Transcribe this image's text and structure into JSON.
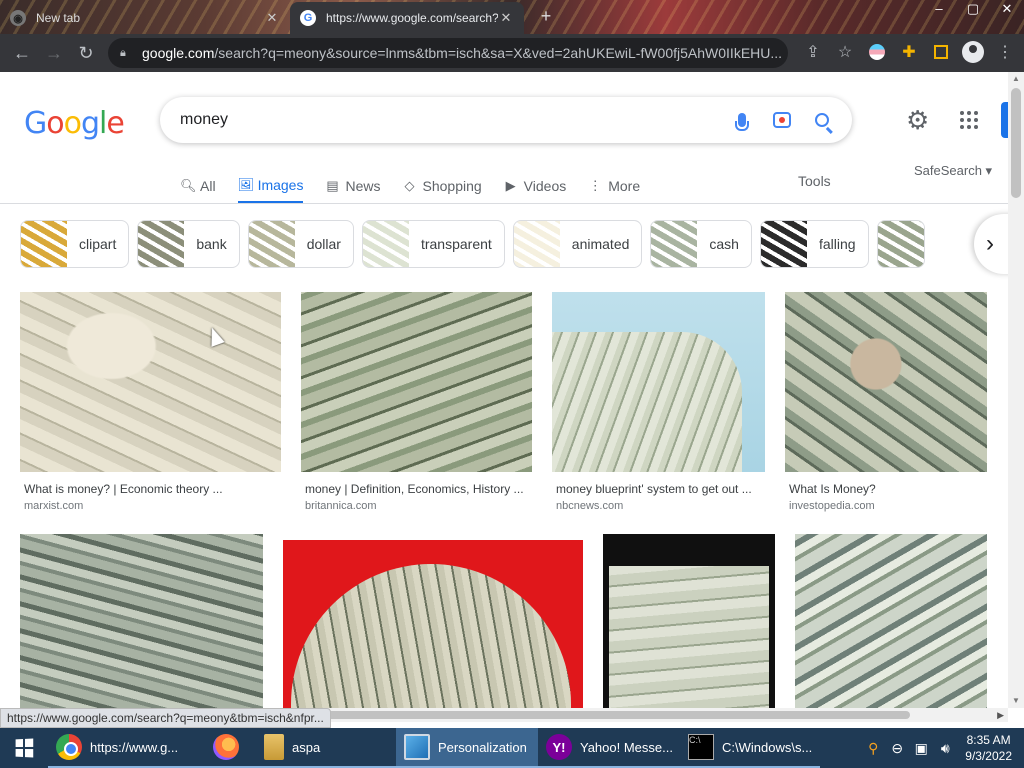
{
  "browser": {
    "tabs": [
      {
        "title": "New tab",
        "active": false
      },
      {
        "title": "https://www.google.com/search?",
        "active": true
      }
    ],
    "new_tab": "+",
    "window_controls": [
      "–",
      "▢",
      "✕"
    ],
    "url_domain": "google.com",
    "url_rest": "/search?q=meony&source=lnms&tbm=isch&sa=X&ved=2ahUKEwiL-fW00fj5AhW0IIkEHU..."
  },
  "google": {
    "logo_letters": [
      "G",
      "o",
      "o",
      "g",
      "l",
      "e"
    ],
    "query": "money",
    "nav_tabs": [
      {
        "label": "All",
        "icon": "🔍︎"
      },
      {
        "label": "Images",
        "icon": "🖼︎"
      },
      {
        "label": "News",
        "icon": "▤"
      },
      {
        "label": "Shopping",
        "icon": "◇"
      },
      {
        "label": "Videos",
        "icon": "▶"
      },
      {
        "label": "More",
        "icon": "⋮"
      }
    ],
    "tools_label": "Tools",
    "safesearch_label": "SafeSearch ▾",
    "chips": [
      {
        "label": "clipart",
        "color": "#d9a93a"
      },
      {
        "label": "bank",
        "color": "#8c8f7a"
      },
      {
        "label": "dollar",
        "color": "#b7b79c"
      },
      {
        "label": "transparent",
        "color": "#dde3d2"
      },
      {
        "label": "animated",
        "color": "#f5f0df"
      },
      {
        "label": "cash",
        "color": "#a9b4a1"
      },
      {
        "label": "falling",
        "color": "#2b2b2b"
      },
      {
        "label": "",
        "color": "#9aa58e"
      }
    ],
    "results": [
      {
        "caption": "What is money? | Economic theory ...",
        "source": "marxist.com"
      },
      {
        "caption": "money | Definition, Economics, History ...",
        "source": "britannica.com"
      },
      {
        "caption": "money blueprint' system to get out ...",
        "source": "nbcnews.com"
      },
      {
        "caption": "What Is Money?",
        "source": "investopedia.com"
      },
      {
        "caption": "",
        "source": ""
      },
      {
        "caption": "",
        "source": ""
      },
      {
        "caption": "",
        "source": ""
      },
      {
        "caption": "",
        "source": ""
      }
    ]
  },
  "status_url": "https://www.google.com/search?q=meony&tbm=isch&nfpr...",
  "taskbar": {
    "items": [
      {
        "label": "https://www.g...",
        "icon": "chrome"
      },
      {
        "label": "",
        "icon": "firefox"
      },
      {
        "label": "aspa",
        "icon": "folder"
      },
      {
        "label": "Personalization",
        "icon": "monitor"
      },
      {
        "label": "Yahoo! Messe...",
        "icon": "yahoo"
      },
      {
        "label": "C:\\Windows\\s...",
        "icon": "cmd"
      }
    ],
    "time": "8:35 AM",
    "date": "9/3/2022"
  }
}
